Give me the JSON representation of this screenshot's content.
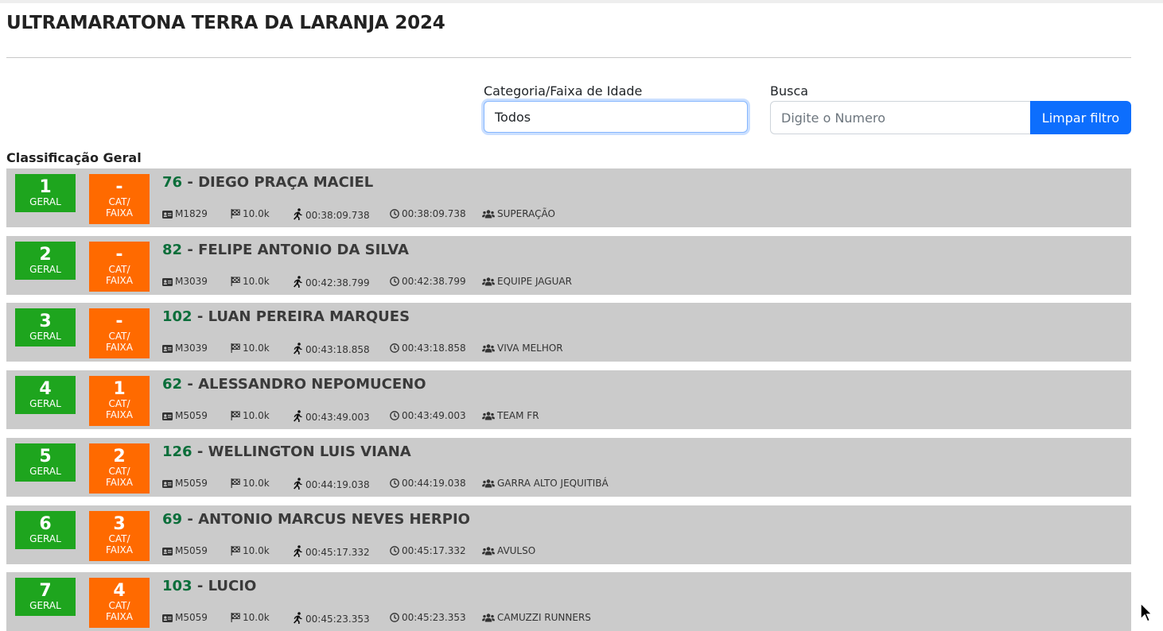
{
  "page": {
    "title": "ULTRAMARATONA TERRA DA LARANJA 2024"
  },
  "filters": {
    "category_label": "Categoria/Faixa de Idade",
    "category_value": "Todos",
    "search_label": "Busca",
    "search_placeholder": "Digite o Numero",
    "clear_button": "Limpar filtro"
  },
  "section_title": "Classificação Geral",
  "badge_labels": {
    "geral": "GERAL",
    "cat": "CAT/\nFAIXA"
  },
  "icons": {
    "category": "id-card-icon",
    "distance": "checkered-flag-icon",
    "pace": "runner-icon",
    "time": "clock-icon",
    "team": "users-icon"
  },
  "colors": {
    "geral_badge": "#1ea51e",
    "cat_badge": "#ff6a00",
    "bib_number": "#0b6e3a",
    "row_background": "#cbcbcb",
    "primary_button": "#0d6efd"
  },
  "results": [
    {
      "geral": "1",
      "cat_pos": "-",
      "bib": "76",
      "name": "DIEGO PRAÇA MACIEL",
      "category": "M1829",
      "distance": "10.0k",
      "time_net": "00:38:09.738",
      "time_gross": "00:38:09.738",
      "team": "SUPERAÇÃO"
    },
    {
      "geral": "2",
      "cat_pos": "-",
      "bib": "82",
      "name": "FELIPE ANTONIO DA SILVA",
      "category": "M3039",
      "distance": "10.0k",
      "time_net": "00:42:38.799",
      "time_gross": "00:42:38.799",
      "team": "EQUIPE JAGUAR"
    },
    {
      "geral": "3",
      "cat_pos": "-",
      "bib": "102",
      "name": "LUAN PEREIRA MARQUES",
      "category": "M3039",
      "distance": "10.0k",
      "time_net": "00:43:18.858",
      "time_gross": "00:43:18.858",
      "team": "VIVA MELHOR"
    },
    {
      "geral": "4",
      "cat_pos": "1",
      "bib": "62",
      "name": "ALESSANDRO NEPOMUCENO",
      "category": "M5059",
      "distance": "10.0k",
      "time_net": "00:43:49.003",
      "time_gross": "00:43:49.003",
      "team": "TEAM FR"
    },
    {
      "geral": "5",
      "cat_pos": "2",
      "bib": "126",
      "name": "WELLINGTON LUIS VIANA",
      "category": "M5059",
      "distance": "10.0k",
      "time_net": "00:44:19.038",
      "time_gross": "00:44:19.038",
      "team": "GARRA ALTO JEQUITIBÁ"
    },
    {
      "geral": "6",
      "cat_pos": "3",
      "bib": "69",
      "name": "ANTONIO MARCUS NEVES HERPIO",
      "category": "M5059",
      "distance": "10.0k",
      "time_net": "00:45:17.332",
      "time_gross": "00:45:17.332",
      "team": "AVULSO"
    },
    {
      "geral": "7",
      "cat_pos": "4",
      "bib": "103",
      "name": "LUCIO",
      "category": "M5059",
      "distance": "10.0k",
      "time_net": "00:45:23.353",
      "time_gross": "00:45:23.353",
      "team": "CAMUZZI RUNNERS"
    }
  ]
}
